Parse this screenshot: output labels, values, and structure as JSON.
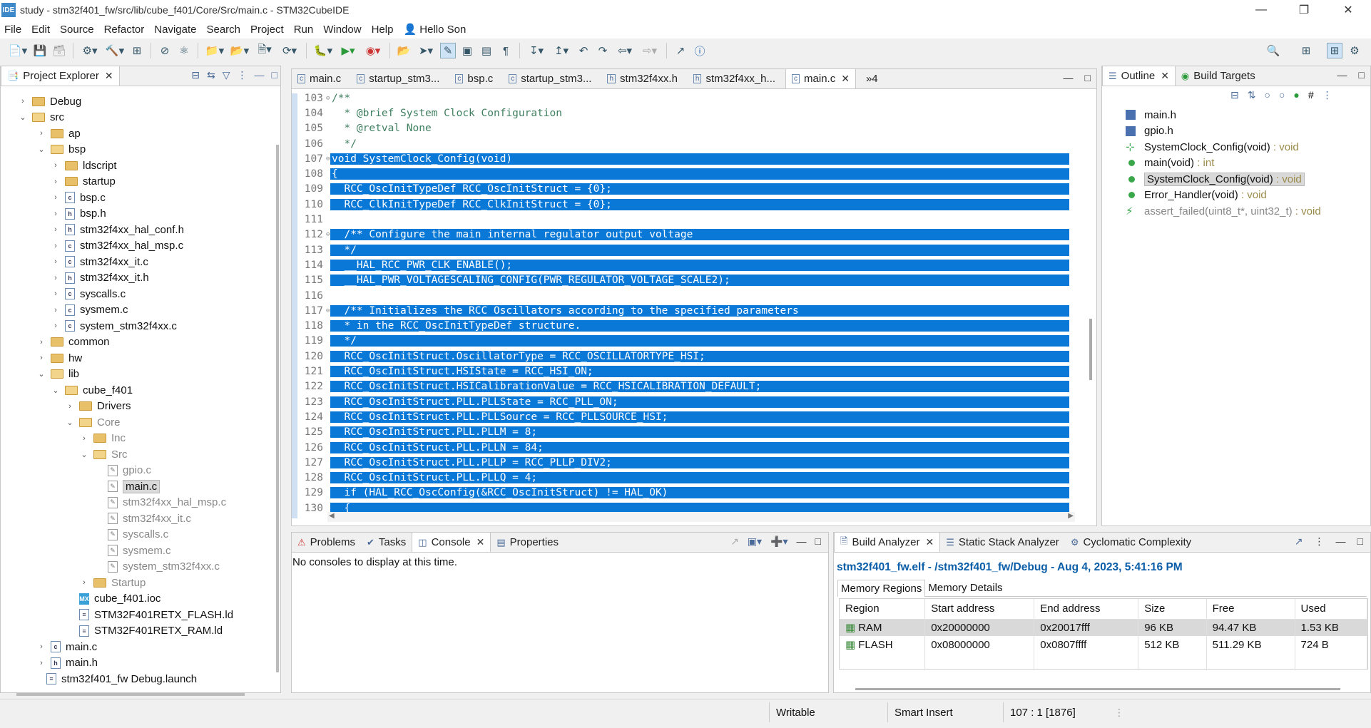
{
  "window": {
    "title": "study - stm32f401_fw/src/lib/cube_f401/Core/Src/main.c - STM32CubeIDE",
    "app_icon": "IDE"
  },
  "menu": [
    "File",
    "Edit",
    "Source",
    "Refactor",
    "Navigate",
    "Search",
    "Project",
    "Run",
    "Window",
    "Help"
  ],
  "menu_user": "Hello Son",
  "project_explorer": {
    "tab": "Project Explorer",
    "rows": [
      {
        "label": "Debug",
        "type": "folder",
        "indent": 1,
        "chevron": "›"
      },
      {
        "label": "src",
        "type": "folder-open",
        "indent": 1,
        "chevron": "⌄"
      },
      {
        "label": "ap",
        "type": "folder",
        "indent": 2,
        "chevron": "›"
      },
      {
        "label": "bsp",
        "type": "folder-open",
        "indent": 2,
        "chevron": "⌄"
      },
      {
        "label": "ldscript",
        "type": "folder",
        "indent": 3,
        "chevron": "›"
      },
      {
        "label": "startup",
        "type": "folder",
        "indent": 3,
        "chevron": "›"
      },
      {
        "label": "bsp.c",
        "type": "c",
        "indent": 3,
        "chevron": "›"
      },
      {
        "label": "bsp.h",
        "type": "h",
        "indent": 3,
        "chevron": "›"
      },
      {
        "label": "stm32f4xx_hal_conf.h",
        "type": "h",
        "indent": 3,
        "chevron": "›"
      },
      {
        "label": "stm32f4xx_hal_msp.c",
        "type": "c",
        "indent": 3,
        "chevron": "›"
      },
      {
        "label": "stm32f4xx_it.c",
        "type": "c",
        "indent": 3,
        "chevron": "›"
      },
      {
        "label": "stm32f4xx_it.h",
        "type": "h",
        "indent": 3,
        "chevron": "›"
      },
      {
        "label": "syscalls.c",
        "type": "c",
        "indent": 3,
        "chevron": "›"
      },
      {
        "label": "sysmem.c",
        "type": "c",
        "indent": 3,
        "chevron": "›"
      },
      {
        "label": "system_stm32f4xx.c",
        "type": "c",
        "indent": 3,
        "chevron": "›"
      },
      {
        "label": "common",
        "type": "folder",
        "indent": 2,
        "chevron": "›"
      },
      {
        "label": "hw",
        "type": "folder",
        "indent": 2,
        "chevron": "›"
      },
      {
        "label": "lib",
        "type": "folder-open",
        "indent": 2,
        "chevron": "⌄"
      },
      {
        "label": "cube_f401",
        "type": "folder-open",
        "indent": 3,
        "chevron": "⌄"
      },
      {
        "label": "Drivers",
        "type": "folder",
        "indent": 4,
        "chevron": "›"
      },
      {
        "label": "Core",
        "type": "folder-open",
        "indent": 4,
        "chevron": "⌄",
        "gray": true
      },
      {
        "label": "Inc",
        "type": "folder",
        "indent": 5,
        "chevron": "›",
        "gray": true
      },
      {
        "label": "Src",
        "type": "folder-open",
        "indent": 5,
        "chevron": "⌄",
        "gray": true
      },
      {
        "label": "gpio.c",
        "type": "cg",
        "indent": 6,
        "chevron": "",
        "gray": true
      },
      {
        "label": "main.c",
        "type": "cg",
        "indent": 6,
        "chevron": "",
        "selected": true
      },
      {
        "label": "stm32f4xx_hal_msp.c",
        "type": "cg",
        "indent": 6,
        "chevron": "",
        "gray": true
      },
      {
        "label": "stm32f4xx_it.c",
        "type": "cg",
        "indent": 6,
        "chevron": "",
        "gray": true
      },
      {
        "label": "syscalls.c",
        "type": "cg",
        "indent": 6,
        "chevron": "",
        "gray": true
      },
      {
        "label": "sysmem.c",
        "type": "cg",
        "indent": 6,
        "chevron": "",
        "gray": true
      },
      {
        "label": "system_stm32f4xx.c",
        "type": "cg",
        "indent": 6,
        "chevron": "",
        "gray": true
      },
      {
        "label": "Startup",
        "type": "folder",
        "indent": 5,
        "chevron": "›",
        "gray": true
      },
      {
        "label": "cube_f401.ioc",
        "type": "mx",
        "indent": 4,
        "chevron": ""
      },
      {
        "label": "STM32F401RETX_FLASH.ld",
        "type": "ld",
        "indent": 4,
        "chevron": ""
      },
      {
        "label": "STM32F401RETX_RAM.ld",
        "type": "ld",
        "indent": 4,
        "chevron": ""
      },
      {
        "label": "main.c",
        "type": "c",
        "indent": 2,
        "chevron": "›"
      },
      {
        "label": "main.h",
        "type": "h",
        "indent": 2,
        "chevron": "›"
      },
      {
        "label": "stm32f401_fw Debug.launch",
        "type": "launch",
        "indent": 1,
        "chevron": ""
      }
    ]
  },
  "editor_tabs": [
    "main.c",
    "startup_stm3...",
    "bsp.c",
    "startup_stm3...",
    "stm32f4xx.h",
    "stm32f4xx_h...",
    "main.c"
  ],
  "editor_overflow": "»4",
  "code_lines": [
    {
      "n": "103",
      "t": "/**",
      "sel": false,
      "fold": "⊖",
      "c": true
    },
    {
      "n": "104",
      "t": "  * @brief System Clock Configuration",
      "sel": false,
      "c": true
    },
    {
      "n": "105",
      "t": "  * @retval None",
      "sel": false,
      "c": true
    },
    {
      "n": "106",
      "t": "  */",
      "sel": false,
      "c": true
    },
    {
      "n": "107",
      "t": "void SystemClock_Config(void)",
      "sel": true,
      "fold": "⊖"
    },
    {
      "n": "108",
      "t": "{",
      "sel": true
    },
    {
      "n": "109",
      "t": "  RCC_OscInitTypeDef RCC_OscInitStruct = {0};",
      "sel": true
    },
    {
      "n": "110",
      "t": "  RCC_ClkInitTypeDef RCC_ClkInitStruct = {0};",
      "sel": true
    },
    {
      "n": "111",
      "t": "",
      "sel": true
    },
    {
      "n": "112",
      "t": "  /** Configure the main internal regulator output voltage",
      "sel": true,
      "fold": "⊖"
    },
    {
      "n": "113",
      "t": "  */",
      "sel": true
    },
    {
      "n": "114",
      "t": "  __HAL_RCC_PWR_CLK_ENABLE();",
      "sel": true
    },
    {
      "n": "115",
      "t": "  __HAL_PWR_VOLTAGESCALING_CONFIG(PWR_REGULATOR_VOLTAGE_SCALE2);",
      "sel": true
    },
    {
      "n": "116",
      "t": "",
      "sel": true
    },
    {
      "n": "117",
      "t": "  /** Initializes the RCC Oscillators according to the specified parameters",
      "sel": true,
      "fold": "⊖"
    },
    {
      "n": "118",
      "t": "  * in the RCC_OscInitTypeDef structure.",
      "sel": true
    },
    {
      "n": "119",
      "t": "  */",
      "sel": true
    },
    {
      "n": "120",
      "t": "  RCC_OscInitStruct.OscillatorType = RCC_OSCILLATORTYPE_HSI;",
      "sel": true
    },
    {
      "n": "121",
      "t": "  RCC_OscInitStruct.HSIState = RCC_HSI_ON;",
      "sel": true
    },
    {
      "n": "122",
      "t": "  RCC_OscInitStruct.HSICalibrationValue = RCC_HSICALIBRATION_DEFAULT;",
      "sel": true
    },
    {
      "n": "123",
      "t": "  RCC_OscInitStruct.PLL.PLLState = RCC_PLL_ON;",
      "sel": true
    },
    {
      "n": "124",
      "t": "  RCC_OscInitStruct.PLL.PLLSource = RCC_PLLSOURCE_HSI;",
      "sel": true
    },
    {
      "n": "125",
      "t": "  RCC_OscInitStruct.PLL.PLLM = 8;",
      "sel": true
    },
    {
      "n": "126",
      "t": "  RCC_OscInitStruct.PLL.PLLN = 84;",
      "sel": true
    },
    {
      "n": "127",
      "t": "  RCC_OscInitStruct.PLL.PLLP = RCC_PLLP_DIV2;",
      "sel": true
    },
    {
      "n": "128",
      "t": "  RCC_OscInitStruct.PLL.PLLQ = 4;",
      "sel": true
    },
    {
      "n": "129",
      "t": "  if (HAL_RCC_OscConfig(&RCC_OscInitStruct) != HAL_OK)",
      "sel": true
    },
    {
      "n": "130",
      "t": "  {",
      "sel": true
    }
  ],
  "outline": {
    "tabs": [
      "Outline",
      "Build Targets"
    ],
    "items": [
      {
        "label": "main.h",
        "suffix": "",
        "icon": "include"
      },
      {
        "label": "gpio.h",
        "suffix": "",
        "icon": "include"
      },
      {
        "label": "SystemClock_Config(void)",
        "suffix": " : void",
        "icon": "declaration"
      },
      {
        "label": "main(void)",
        "suffix": " : int",
        "icon": "function"
      },
      {
        "label": "SystemClock_Config(void)",
        "suffix": " : void",
        "icon": "function",
        "selected": true
      },
      {
        "label": "Error_Handler(void)",
        "suffix": " : void",
        "icon": "function"
      },
      {
        "label": "assert_failed(uint8_t*, uint32_t)",
        "suffix": " : void",
        "icon": "function-disabled"
      }
    ]
  },
  "console": {
    "tabs": [
      "Problems",
      "Tasks",
      "Console",
      "Properties"
    ],
    "message": "No consoles to display at this time."
  },
  "build_analyzer": {
    "tabs": [
      "Build Analyzer",
      "Static Stack Analyzer",
      "Cyclomatic Complexity"
    ],
    "header": "stm32f401_fw.elf - /stm32f401_fw/Debug - Aug 4, 2023, 5:41:16 PM",
    "subtabs": [
      "Memory Regions",
      "Memory Details"
    ],
    "columns": [
      "Region",
      "Start address",
      "End address",
      "Size",
      "Free",
      "Used"
    ],
    "rows": [
      [
        "RAM",
        "0x20000000",
        "0x20017fff",
        "96 KB",
        "94.47 KB",
        "1.53 KB"
      ],
      [
        "FLASH",
        "0x08000000",
        "0x0807ffff",
        "512 KB",
        "511.29 KB",
        "724 B"
      ]
    ]
  },
  "status": {
    "writable": "Writable",
    "insert": "Smart Insert",
    "position": "107 : 1 [1876]"
  },
  "colors": {
    "selection": "#0a78d7",
    "comment": "#3f7f5f",
    "accent": "#0a5ea8"
  }
}
